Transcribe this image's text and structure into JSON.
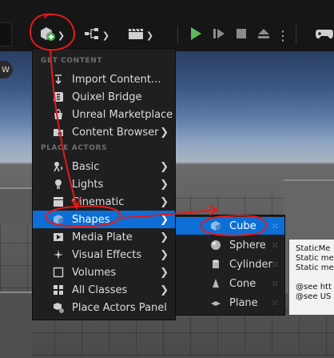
{
  "menu": {
    "sections": [
      "GET CONTENT",
      "PLACE ACTORS"
    ],
    "items": [
      {
        "label": "Import Content...",
        "icon": "import-icon",
        "submenu": false
      },
      {
        "label": "Quixel Bridge",
        "icon": "quixel-bridge-icon",
        "submenu": false
      },
      {
        "label": "Unreal Marketplace",
        "icon": "marketplace-icon",
        "submenu": false
      },
      {
        "label": "Content Browser",
        "icon": "content-browser-icon",
        "submenu": true
      },
      {
        "label": "Basic",
        "icon": "basic-actors-icon",
        "submenu": true
      },
      {
        "label": "Lights",
        "icon": "light-bulb-icon",
        "submenu": true
      },
      {
        "label": "Cinematic",
        "icon": "clapperboard-icon",
        "submenu": true
      },
      {
        "label": "Shapes",
        "icon": "cube-icon",
        "submenu": true,
        "selected": true
      },
      {
        "label": "Media Plate",
        "icon": "media-plate-icon",
        "submenu": true
      },
      {
        "label": "Visual Effects",
        "icon": "sparkle-icon",
        "submenu": true
      },
      {
        "label": "Volumes",
        "icon": "volume-icon",
        "submenu": true
      },
      {
        "label": "All Classes",
        "icon": "all-classes-icon",
        "submenu": true
      },
      {
        "label": "Place Actors Panel",
        "icon": "place-actors-icon",
        "submenu": false
      }
    ]
  },
  "shapes_submenu": {
    "items": [
      {
        "label": "Cube",
        "icon": "cube-icon",
        "selected": true
      },
      {
        "label": "Sphere",
        "icon": "sphere-icon"
      },
      {
        "label": "Cylinder",
        "icon": "cylinder-icon"
      },
      {
        "label": "Cone",
        "icon": "cone-icon"
      },
      {
        "label": "Plane",
        "icon": "plane-icon"
      }
    ]
  },
  "tooltip": {
    "lines": [
      "StaticMe",
      "Static me",
      "Static me",
      "",
      "@see htt",
      "@see US"
    ]
  },
  "viewport": {
    "badge": "W"
  },
  "colors": {
    "selection": "#0d6fd6",
    "annotation": "#e31a1a",
    "play": "#5cb85c"
  }
}
